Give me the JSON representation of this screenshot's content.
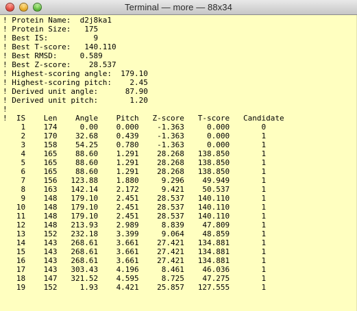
{
  "window": {
    "title": "Terminal — more — 88x34",
    "background": "#ffffc0"
  },
  "terminal": {
    "lines": [
      "! Protein Name:  d2j8ka1",
      "! Protein Size:   175",
      "! Best IS:          9",
      "! Best T-score:   140.110",
      "! Best RMSD:     0.589",
      "! Best Z-score:    28.537",
      "! Highest-scoring angle:  179.10",
      "! Highest-scoring pitch:    2.45",
      "! Derived unit angle:      87.90",
      "! Derived unit pitch:       1.20",
      "!",
      "!  IS    Len    Angle    Pitch   Z-score   T-score   Candidate",
      "    1    174     0.00    0.000    -1.363     0.000       0",
      "    2    170    32.68    0.439    -1.363     0.000       1",
      "    3    158    54.25    0.780    -1.363     0.000       1",
      "    4    165    88.60    1.291    28.268   138.850       1",
      "    5    165    88.60    1.291    28.268   138.850       1",
      "    6    165    88.60    1.291    28.268   138.850       1",
      "    7    156   123.88    1.880     9.296    49.949       1",
      "    8    163   142.14    2.172     9.421    50.537       1",
      "    9    148   179.10    2.451    28.537   140.110       1",
      "   10    148   179.10    2.451    28.537   140.110       1",
      "   11    148   179.10    2.451    28.537   140.110       1",
      "   12    148   213.93    2.989     8.839    47.809       1",
      "   13    152   232.18    3.399     9.064    48.859       1",
      "   14    143   268.61    3.661    27.421   134.881       1",
      "   15    143   268.61    3.661    27.421   134.881       1",
      "   16    143   268.61    3.661    27.421   134.881       1",
      "   17    143   303.43    4.196     8.461    46.036       1",
      "   18    147   321.52    4.595     8.725    47.275       1",
      "   19    152     1.93    4.421    25.857   127.555       1"
    ]
  }
}
